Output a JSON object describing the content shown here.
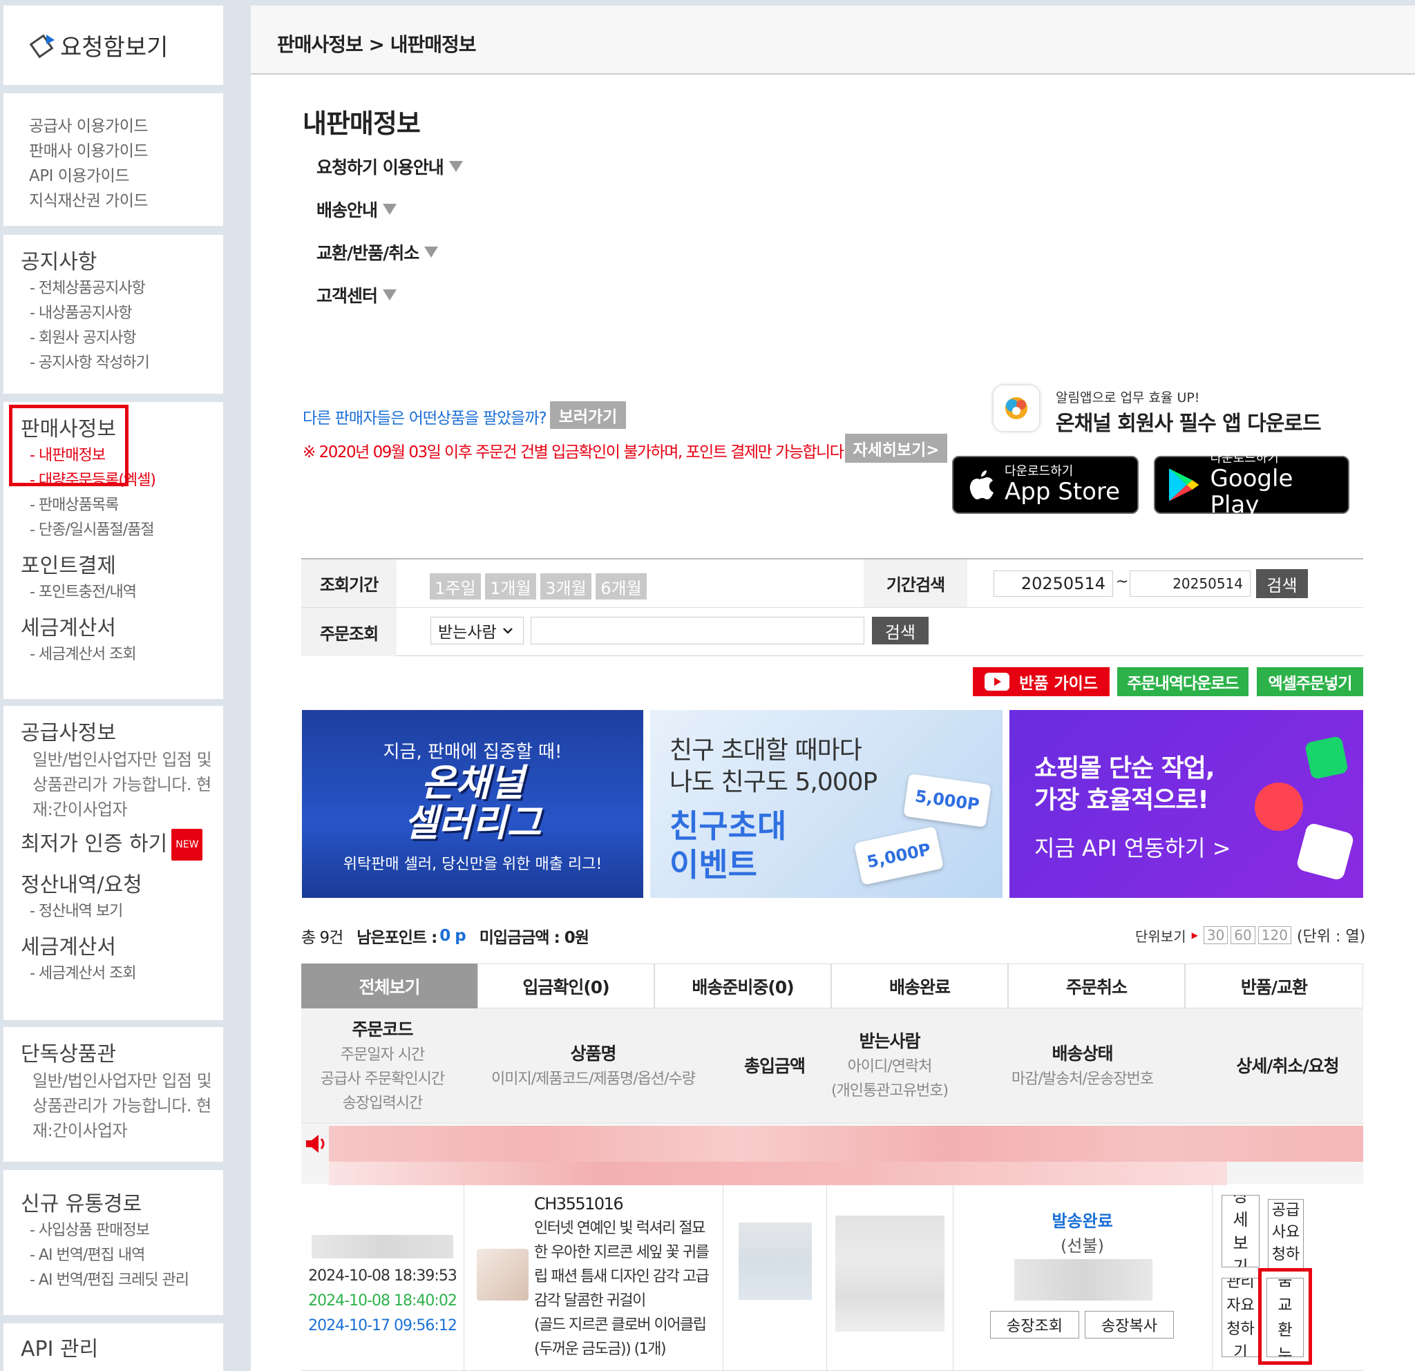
{
  "sidebar": {
    "logo_text": "요청함보기",
    "guides": [
      "공급사 이용가이드",
      "판매사 이용가이드",
      "API 이용가이드",
      "지식재산권 가이드"
    ],
    "notice": {
      "title": "공지사항",
      "items": [
        "- 전체상품공지사항",
        "- 내상품공지사항",
        "- 회원사 공지사항",
        "- 공지사항 작성하기"
      ]
    },
    "seller": {
      "title": "판매사정보",
      "items": [
        "- 내판매정보",
        "- 대량주문등록(엑셀)",
        "- 판매상품목록",
        "- 단종/일시품절/품절"
      ]
    },
    "point": {
      "title": "포인트결제",
      "items": [
        "- 포인트충전/내역"
      ]
    },
    "tax1": {
      "title": "세금계산서",
      "items": [
        "- 세금계산서 조회"
      ]
    },
    "supplier": {
      "title": "공급사정보",
      "desc": "일반/법인사업자만 입점 및 상품관리가 가능합니다. 현재:간이사업자"
    },
    "lowest": {
      "title": "최저가 인증 하기",
      "badge": "NEW"
    },
    "settle": {
      "title": "정산내역/요청",
      "items": [
        "- 정산내역 보기"
      ]
    },
    "tax2": {
      "title": "세금계산서",
      "items": [
        "- 세금계산서 조회"
      ]
    },
    "exclusive": {
      "title": "단독상품관",
      "desc": "일반/법인사업자만 입점 및 상품관리가 가능합니다. 현재:간이사업자"
    },
    "channel": {
      "title": "신규 유통경로",
      "items": [
        "- 사입상품 판매정보",
        "- AI 번역/편집 내역",
        "- AI 번역/편집 크레딧 관리"
      ]
    },
    "api": {
      "title": "API 관리"
    }
  },
  "breadcrumb": "판매사정보 > 내판매정보",
  "page_title": "내판매정보",
  "accordions": [
    "요청하기 이용안내",
    "배송안내",
    "교환/반품/취소",
    "고객센터"
  ],
  "promo": {
    "question": "다른 판매자들은 어떤상품을 팔았을까?",
    "view_btn": "보러가기",
    "warning": "※ 2020년 09월 03일 이후 주문건 건별 입금확인이 불가하며, 포인트 결제만 가능합니다.",
    "detail_btn": "자세히보기>"
  },
  "app": {
    "sub": "알림앱으로 업무 효율 UP!",
    "title": "온채널 회원사 필수 앱 다운로드",
    "appstore_small": "다운로드하기",
    "appstore_big": "App Store",
    "google_small": "다운로드하기",
    "google_big": "Google Play"
  },
  "filter": {
    "period_label": "조회기간",
    "periods": [
      "1주일",
      "1개월",
      "3개월",
      "6개월"
    ],
    "range_label": "기간검색",
    "date_from": "20250514",
    "tilde": "~",
    "date_to": "20250514",
    "search_btn": "검색",
    "order_label": "주문조회",
    "select_value": "받는사람",
    "search_btn2": "검색"
  },
  "actions": {
    "return_guide": "반품 가이드",
    "download": "주문내역다운로드",
    "excel": "엑셀주문넣기"
  },
  "banners": {
    "b1_top": "지금, 판매에 집중할 때!",
    "b1_big1": "온채널",
    "b1_big2": "셀러리그",
    "b1_bottom": "위탁판매 셀러, 당신만을 위한 매출 리그!",
    "b2_line1": "친구 초대할 때마다",
    "b2_line2": "나도 친구도 5,000P",
    "b2_big1": "친구초대",
    "b2_big2": "이벤트",
    "b2_coupon": "5,000P",
    "b3_line1": "쇼핑몰 단순 작업,",
    "b3_line2": "가장 효율적으로!",
    "b3_line3": "지금 API 연동하기 >"
  },
  "summary": {
    "total": "총 9건",
    "remain_label": "남은포인트 :",
    "remain_val": "0 p",
    "unpaid": "미입금금액 : 0원",
    "unit_label": "단위보기",
    "units": [
      "30",
      "60",
      "120"
    ],
    "unit_suffix": "(단위 : 열)"
  },
  "tabs": [
    "전체보기",
    "입금확인(0)",
    "배송준비중(0)",
    "배송완료",
    "주문취소",
    "반품/교환"
  ],
  "headers": {
    "order": {
      "title": "주문코드",
      "lines": [
        "주문일자 시간",
        "공급사 주문확인시간",
        "송장입력시간"
      ]
    },
    "product": {
      "title": "상품명",
      "lines": [
        "이미지/제품코드/제품명/옵션/수량"
      ]
    },
    "amount": {
      "title": "총입금액"
    },
    "receiver": {
      "title": "받는사람",
      "lines": [
        "아이디/연락처",
        "(개인통관고유번호)"
      ]
    },
    "status": {
      "title": "배송상태",
      "lines": [
        "마감/발송처/운송장번호"
      ]
    },
    "detail": {
      "title": "상세/취소/요청"
    }
  },
  "row": {
    "times": [
      "2024-10-08 18:39:53",
      "2024-10-08 18:40:02",
      "2024-10-17 09:56:12"
    ],
    "code": "CH3551016",
    "name": "인터넷 연예인 빛 럭셔리 절묘한 우아한 지르콘 세잎 꽃 귀를 립 패션 틈새 디자인 감각 고급 감각 달콤한 귀걸이",
    "option": "(골드 지르콘 클로버 이어클립(두꺼운 금도금)) (1개)",
    "ship_status": "발송완료",
    "ship_type": "(선불)",
    "track_btn": "송장조회",
    "copy_btn": "송장복사",
    "detail_btn": "상세보기",
    "supplier_req": "공급사요청하기",
    "admin_req": "관리자요청하기",
    "return_btn": "반품교환누락"
  },
  "colors": {
    "red": "#e60012",
    "blue": "#1a6fd6",
    "green": "#2db24a",
    "tab_active": "#999999"
  }
}
